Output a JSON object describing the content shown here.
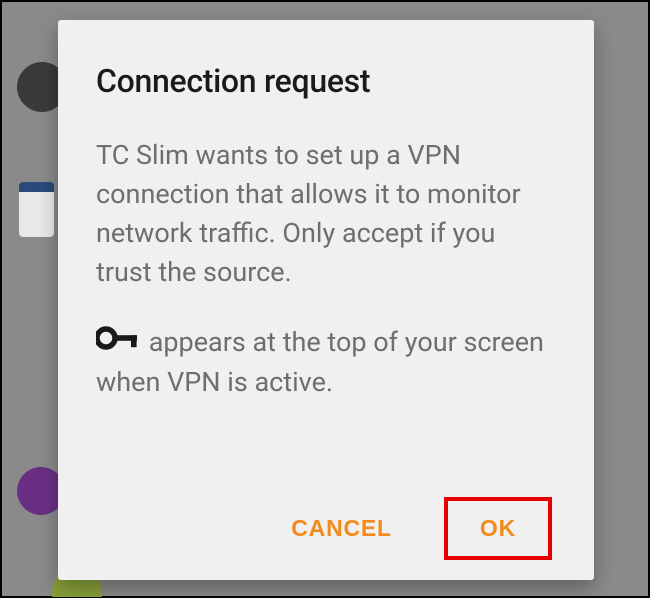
{
  "dialog": {
    "title": "Connection request",
    "body_p1": "TC Slim wants to set up a VPN connection that allows it to monitor network traffic. Only accept if you trust the source.",
    "body_p2": " appears at the top of your screen when VPN is active.",
    "icon": "key-icon",
    "cancel_label": "CANCEL",
    "ok_label": "OK"
  }
}
